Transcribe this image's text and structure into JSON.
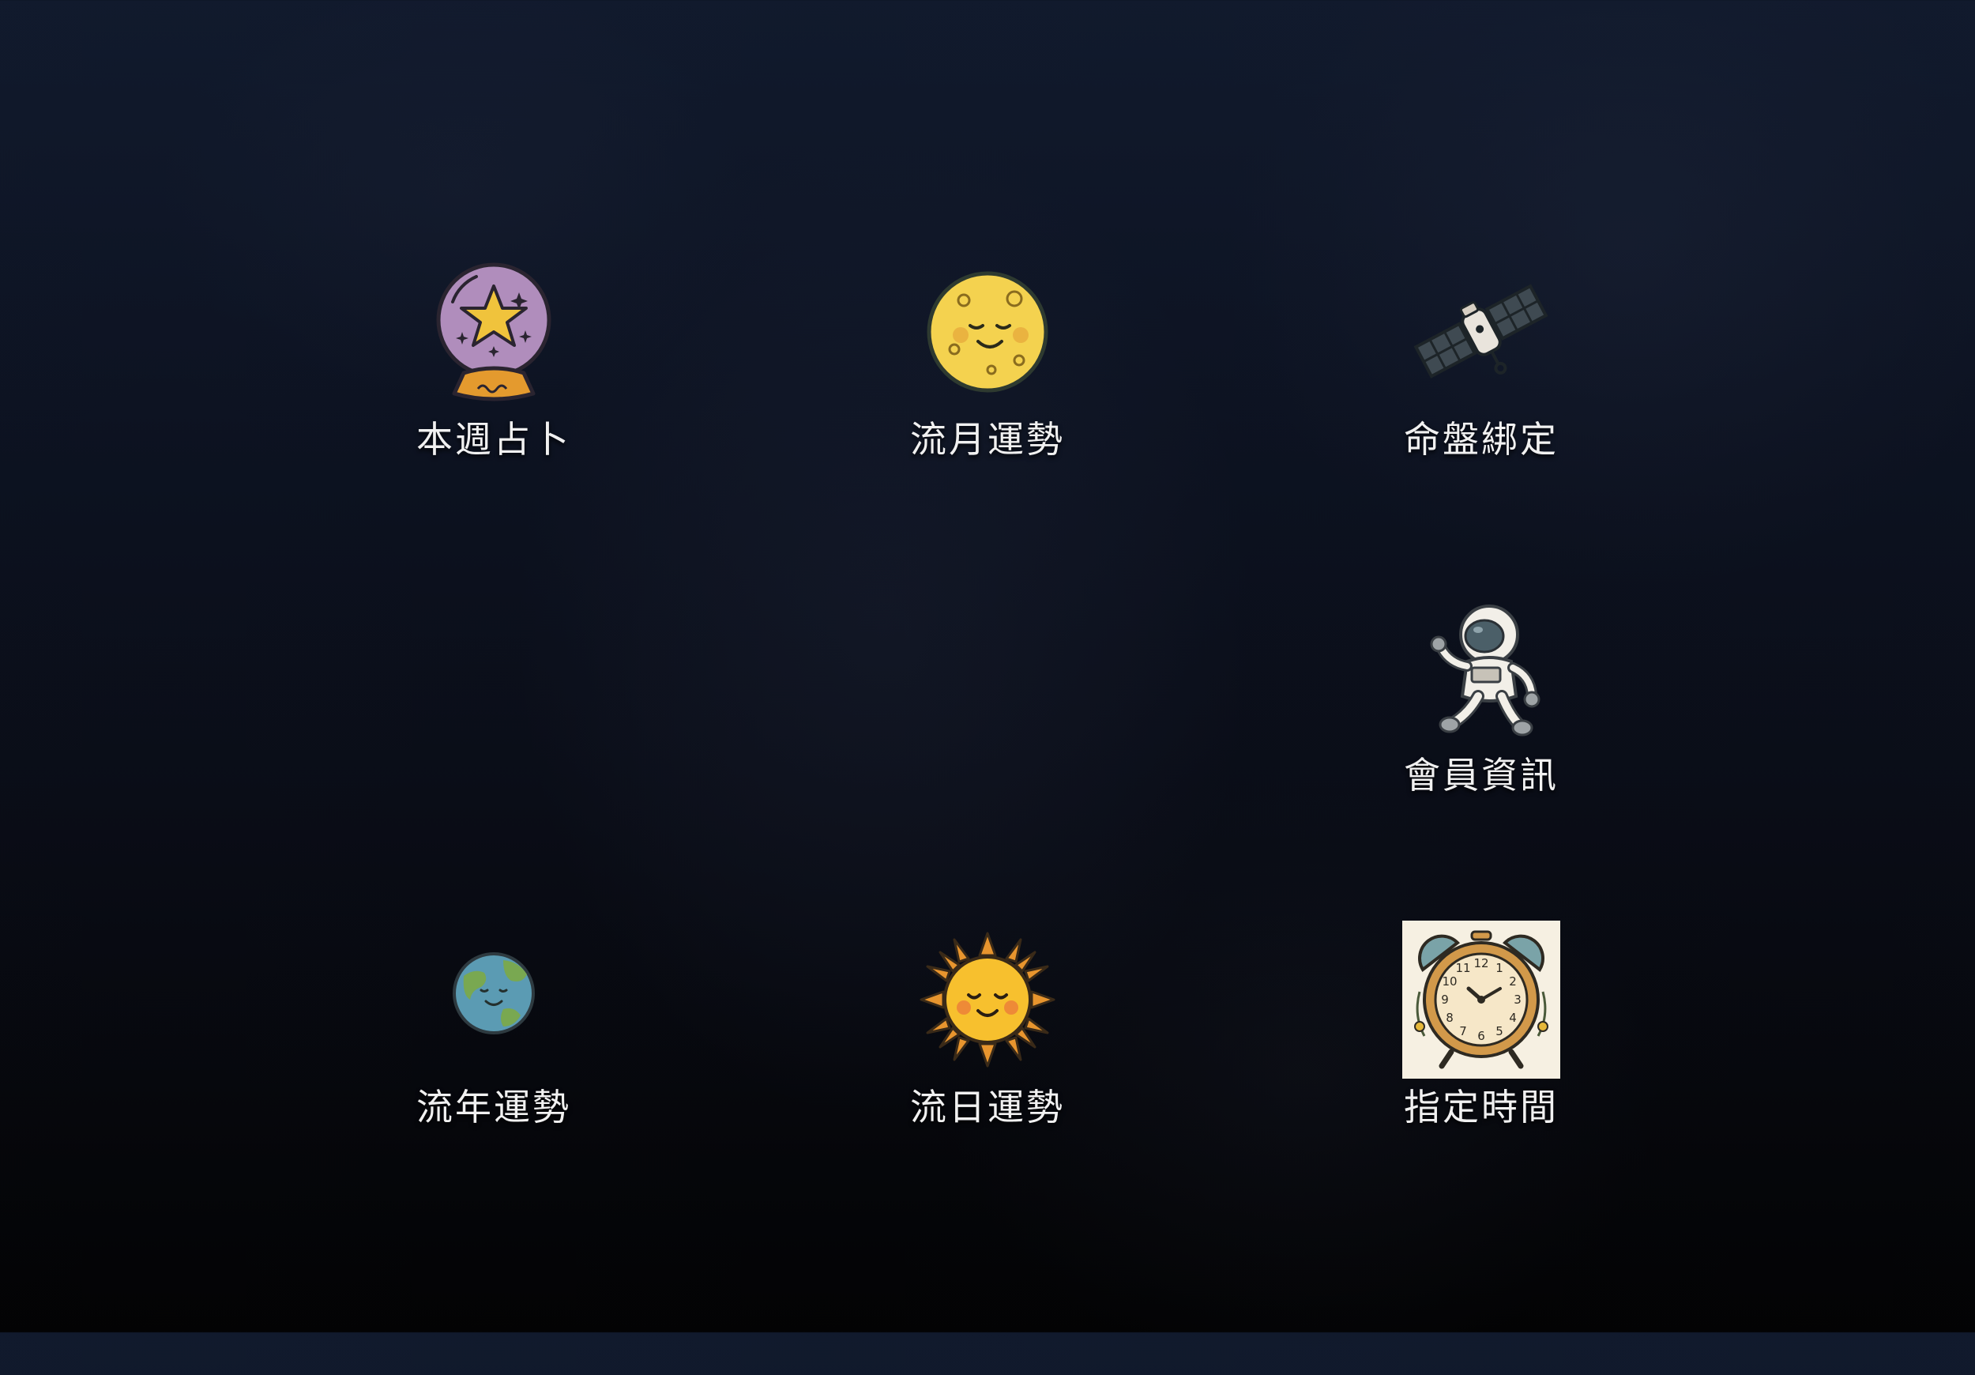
{
  "menu": {
    "items": [
      {
        "label": "本週占卜",
        "icon": "crystal-ball-icon"
      },
      {
        "label": "流月運勢",
        "icon": "moon-icon"
      },
      {
        "label": "命盤綁定",
        "icon": "satellite-icon"
      },
      {
        "label": "會員資訊",
        "icon": "astronaut-icon"
      },
      {
        "label": "流年運勢",
        "icon": "earth-icon"
      },
      {
        "label": "流日運勢",
        "icon": "sun-icon"
      },
      {
        "label": "指定時間",
        "icon": "alarm-clock-icon"
      }
    ]
  },
  "colors": {
    "background_top": "#111a2d",
    "background_bottom": "#030304",
    "label_text": "#f1f1f1"
  }
}
